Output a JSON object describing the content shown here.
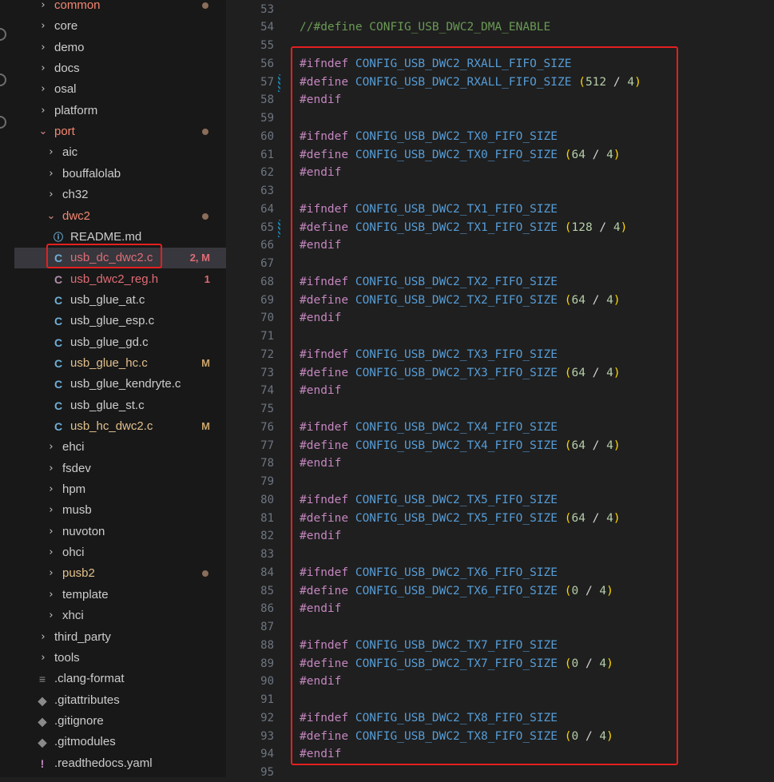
{
  "explorer": {
    "items": [
      {
        "label": "common",
        "chev": "›",
        "depth": 1,
        "color": "red",
        "dot": true
      },
      {
        "label": "core",
        "chev": "›",
        "depth": 1
      },
      {
        "label": "demo",
        "chev": "›",
        "depth": 1
      },
      {
        "label": "docs",
        "chev": "›",
        "depth": 1
      },
      {
        "label": "osal",
        "chev": "›",
        "depth": 1
      },
      {
        "label": "platform",
        "chev": "›",
        "depth": 1
      },
      {
        "label": "port",
        "chev": "⌄",
        "depth": 1,
        "color": "red",
        "dot": true,
        "open": true
      },
      {
        "label": "aic",
        "chev": "›",
        "depth": 2
      },
      {
        "label": "bouffalolab",
        "chev": "›",
        "depth": 2
      },
      {
        "label": "ch32",
        "chev": "›",
        "depth": 2
      },
      {
        "label": "dwc2",
        "chev": "⌄",
        "depth": 2,
        "color": "red",
        "dot": true,
        "open": true
      },
      {
        "label": "README.md",
        "icon": "ⓘ",
        "iconClass": "info",
        "depth": 3
      },
      {
        "label": "usb_dc_dwc2.c",
        "icon": "C",
        "iconClass": "c",
        "depth": 3,
        "color": "red",
        "badge": "2, M",
        "badgeColor": "red",
        "active": true
      },
      {
        "label": "usb_dwc2_reg.h",
        "icon": "C",
        "iconClass": "c err",
        "depth": 3,
        "color": "red",
        "badge": "1",
        "badgeColor": "red"
      },
      {
        "label": "usb_glue_at.c",
        "icon": "C",
        "iconClass": "c",
        "depth": 3
      },
      {
        "label": "usb_glue_esp.c",
        "icon": "C",
        "iconClass": "c",
        "depth": 3
      },
      {
        "label": "usb_glue_gd.c",
        "icon": "C",
        "iconClass": "c",
        "depth": 3
      },
      {
        "label": "usb_glue_hc.c",
        "icon": "C",
        "iconClass": "c",
        "depth": 3,
        "color": "yellow",
        "badge": "M",
        "badgeColor": "yellow"
      },
      {
        "label": "usb_glue_kendryte.c",
        "icon": "C",
        "iconClass": "c",
        "depth": 3
      },
      {
        "label": "usb_glue_st.c",
        "icon": "C",
        "iconClass": "c",
        "depth": 3
      },
      {
        "label": "usb_hc_dwc2.c",
        "icon": "C",
        "iconClass": "c",
        "depth": 3,
        "color": "yellow",
        "badge": "M",
        "badgeColor": "yellow"
      },
      {
        "label": "ehci",
        "chev": "›",
        "depth": 2
      },
      {
        "label": "fsdev",
        "chev": "›",
        "depth": 2
      },
      {
        "label": "hpm",
        "chev": "›",
        "depth": 2
      },
      {
        "label": "musb",
        "chev": "›",
        "depth": 2
      },
      {
        "label": "nuvoton",
        "chev": "›",
        "depth": 2
      },
      {
        "label": "ohci",
        "chev": "›",
        "depth": 2
      },
      {
        "label": "pusb2",
        "chev": "›",
        "depth": 2,
        "color": "yellow",
        "dot": true
      },
      {
        "label": "template",
        "chev": "›",
        "depth": 2
      },
      {
        "label": "xhci",
        "chev": "›",
        "depth": 2
      },
      {
        "label": "third_party",
        "chev": "›",
        "depth": 1
      },
      {
        "label": "tools",
        "chev": "›",
        "depth": 1
      },
      {
        "label": ".clang-format",
        "icon": "≡",
        "iconClass": "gray",
        "depth": 1
      },
      {
        "label": ".gitattributes",
        "icon": "◆",
        "iconClass": "gray",
        "depth": 1
      },
      {
        "label": ".gitignore",
        "icon": "◆",
        "iconClass": "gray",
        "depth": 1
      },
      {
        "label": ".gitmodules",
        "icon": "◆",
        "iconClass": "gray",
        "depth": 1
      },
      {
        "label": ".readthedocs.yaml",
        "icon": "!",
        "iconClass": "purple",
        "depth": 1
      }
    ]
  },
  "editor": {
    "lines": [
      {
        "n": "53",
        "t": []
      },
      {
        "n": "54",
        "t": [
          [
            "cm",
            "//#define CONFIG_USB_DWC2_DMA_ENABLE"
          ]
        ]
      },
      {
        "n": "55",
        "t": []
      },
      {
        "n": "56",
        "t": [
          [
            "kw",
            "#ifndef"
          ],
          [
            "op",
            " "
          ],
          [
            "mac",
            "CONFIG_USB_DWC2_RXALL_FIFO_SIZE"
          ]
        ]
      },
      {
        "n": "57",
        "t": [
          [
            "kw",
            "#define"
          ],
          [
            "op",
            " "
          ],
          [
            "mac",
            "CONFIG_USB_DWC2_RXALL_FIFO_SIZE"
          ],
          [
            "op",
            " "
          ],
          [
            "par",
            "("
          ],
          [
            "num",
            "512"
          ],
          [
            "op",
            " / "
          ],
          [
            "num",
            "4"
          ],
          [
            "par",
            ")"
          ]
        ],
        "mod": true
      },
      {
        "n": "58",
        "t": [
          [
            "kw",
            "#endif"
          ]
        ]
      },
      {
        "n": "59",
        "t": []
      },
      {
        "n": "60",
        "t": [
          [
            "kw",
            "#ifndef"
          ],
          [
            "op",
            " "
          ],
          [
            "mac",
            "CONFIG_USB_DWC2_TX0_FIFO_SIZE"
          ]
        ]
      },
      {
        "n": "61",
        "t": [
          [
            "kw",
            "#define"
          ],
          [
            "op",
            " "
          ],
          [
            "mac",
            "CONFIG_USB_DWC2_TX0_FIFO_SIZE"
          ],
          [
            "op",
            " "
          ],
          [
            "par",
            "("
          ],
          [
            "num",
            "64"
          ],
          [
            "op",
            " / "
          ],
          [
            "num",
            "4"
          ],
          [
            "par",
            ")"
          ]
        ]
      },
      {
        "n": "62",
        "t": [
          [
            "kw",
            "#endif"
          ]
        ]
      },
      {
        "n": "63",
        "t": []
      },
      {
        "n": "64",
        "t": [
          [
            "kw",
            "#ifndef"
          ],
          [
            "op",
            " "
          ],
          [
            "mac",
            "CONFIG_USB_DWC2_TX1_FIFO_SIZE"
          ]
        ]
      },
      {
        "n": "65",
        "t": [
          [
            "kw",
            "#define"
          ],
          [
            "op",
            " "
          ],
          [
            "mac",
            "CONFIG_USB_DWC2_TX1_FIFO_SIZE"
          ],
          [
            "op",
            " "
          ],
          [
            "par",
            "("
          ],
          [
            "num",
            "128"
          ],
          [
            "op",
            " / "
          ],
          [
            "num",
            "4"
          ],
          [
            "par",
            ")"
          ]
        ],
        "mod": true
      },
      {
        "n": "66",
        "t": [
          [
            "kw",
            "#endif"
          ]
        ]
      },
      {
        "n": "67",
        "t": []
      },
      {
        "n": "68",
        "t": [
          [
            "kw",
            "#ifndef"
          ],
          [
            "op",
            " "
          ],
          [
            "mac",
            "CONFIG_USB_DWC2_TX2_FIFO_SIZE"
          ]
        ]
      },
      {
        "n": "69",
        "t": [
          [
            "kw",
            "#define"
          ],
          [
            "op",
            " "
          ],
          [
            "mac",
            "CONFIG_USB_DWC2_TX2_FIFO_SIZE"
          ],
          [
            "op",
            " "
          ],
          [
            "par",
            "("
          ],
          [
            "num",
            "64"
          ],
          [
            "op",
            " / "
          ],
          [
            "num",
            "4"
          ],
          [
            "par",
            ")"
          ]
        ]
      },
      {
        "n": "70",
        "t": [
          [
            "kw",
            "#endif"
          ]
        ]
      },
      {
        "n": "71",
        "t": []
      },
      {
        "n": "72",
        "t": [
          [
            "kw",
            "#ifndef"
          ],
          [
            "op",
            " "
          ],
          [
            "mac",
            "CONFIG_USB_DWC2_TX3_FIFO_SIZE"
          ]
        ]
      },
      {
        "n": "73",
        "t": [
          [
            "kw",
            "#define"
          ],
          [
            "op",
            " "
          ],
          [
            "mac",
            "CONFIG_USB_DWC2_TX3_FIFO_SIZE"
          ],
          [
            "op",
            " "
          ],
          [
            "par",
            "("
          ],
          [
            "num",
            "64"
          ],
          [
            "op",
            " / "
          ],
          [
            "num",
            "4"
          ],
          [
            "par",
            ")"
          ]
        ]
      },
      {
        "n": "74",
        "t": [
          [
            "kw",
            "#endif"
          ]
        ]
      },
      {
        "n": "75",
        "t": []
      },
      {
        "n": "76",
        "t": [
          [
            "kw",
            "#ifndef"
          ],
          [
            "op",
            " "
          ],
          [
            "mac",
            "CONFIG_USB_DWC2_TX4_FIFO_SIZE"
          ]
        ]
      },
      {
        "n": "77",
        "t": [
          [
            "kw",
            "#define"
          ],
          [
            "op",
            " "
          ],
          [
            "mac",
            "CONFIG_USB_DWC2_TX4_FIFO_SIZE"
          ],
          [
            "op",
            " "
          ],
          [
            "par",
            "("
          ],
          [
            "num",
            "64"
          ],
          [
            "op",
            " / "
          ],
          [
            "num",
            "4"
          ],
          [
            "par",
            ")"
          ]
        ]
      },
      {
        "n": "78",
        "t": [
          [
            "kw",
            "#endif"
          ]
        ]
      },
      {
        "n": "79",
        "t": []
      },
      {
        "n": "80",
        "t": [
          [
            "kw",
            "#ifndef"
          ],
          [
            "op",
            " "
          ],
          [
            "mac",
            "CONFIG_USB_DWC2_TX5_FIFO_SIZE"
          ]
        ]
      },
      {
        "n": "81",
        "t": [
          [
            "kw",
            "#define"
          ],
          [
            "op",
            " "
          ],
          [
            "mac",
            "CONFIG_USB_DWC2_TX5_FIFO_SIZE"
          ],
          [
            "op",
            " "
          ],
          [
            "par",
            "("
          ],
          [
            "num",
            "64"
          ],
          [
            "op",
            " / "
          ],
          [
            "num",
            "4"
          ],
          [
            "par",
            ")"
          ]
        ]
      },
      {
        "n": "82",
        "t": [
          [
            "kw",
            "#endif"
          ]
        ]
      },
      {
        "n": "83",
        "t": []
      },
      {
        "n": "84",
        "t": [
          [
            "kw",
            "#ifndef"
          ],
          [
            "op",
            " "
          ],
          [
            "mac",
            "CONFIG_USB_DWC2_TX6_FIFO_SIZE"
          ]
        ]
      },
      {
        "n": "85",
        "t": [
          [
            "kw",
            "#define"
          ],
          [
            "op",
            " "
          ],
          [
            "mac",
            "CONFIG_USB_DWC2_TX6_FIFO_SIZE"
          ],
          [
            "op",
            " "
          ],
          [
            "par",
            "("
          ],
          [
            "num",
            "0"
          ],
          [
            "op",
            " / "
          ],
          [
            "num",
            "4"
          ],
          [
            "par",
            ")"
          ]
        ]
      },
      {
        "n": "86",
        "t": [
          [
            "kw",
            "#endif"
          ]
        ]
      },
      {
        "n": "87",
        "t": []
      },
      {
        "n": "88",
        "t": [
          [
            "kw",
            "#ifndef"
          ],
          [
            "op",
            " "
          ],
          [
            "mac",
            "CONFIG_USB_DWC2_TX7_FIFO_SIZE"
          ]
        ]
      },
      {
        "n": "89",
        "t": [
          [
            "kw",
            "#define"
          ],
          [
            "op",
            " "
          ],
          [
            "mac",
            "CONFIG_USB_DWC2_TX7_FIFO_SIZE"
          ],
          [
            "op",
            " "
          ],
          [
            "par",
            "("
          ],
          [
            "num",
            "0"
          ],
          [
            "op",
            " / "
          ],
          [
            "num",
            "4"
          ],
          [
            "par",
            ")"
          ]
        ]
      },
      {
        "n": "90",
        "t": [
          [
            "kw",
            "#endif"
          ]
        ]
      },
      {
        "n": "91",
        "t": []
      },
      {
        "n": "92",
        "t": [
          [
            "kw",
            "#ifndef"
          ],
          [
            "op",
            " "
          ],
          [
            "mac",
            "CONFIG_USB_DWC2_TX8_FIFO_SIZE"
          ]
        ]
      },
      {
        "n": "93",
        "t": [
          [
            "kw",
            "#define"
          ],
          [
            "op",
            " "
          ],
          [
            "mac",
            "CONFIG_USB_DWC2_TX8_FIFO_SIZE"
          ],
          [
            "op",
            " "
          ],
          [
            "par",
            "("
          ],
          [
            "num",
            "0"
          ],
          [
            "op",
            " / "
          ],
          [
            "num",
            "4"
          ],
          [
            "par",
            ")"
          ]
        ]
      },
      {
        "n": "94",
        "t": [
          [
            "kw",
            "#endif"
          ]
        ]
      },
      {
        "n": "95",
        "t": []
      }
    ]
  }
}
